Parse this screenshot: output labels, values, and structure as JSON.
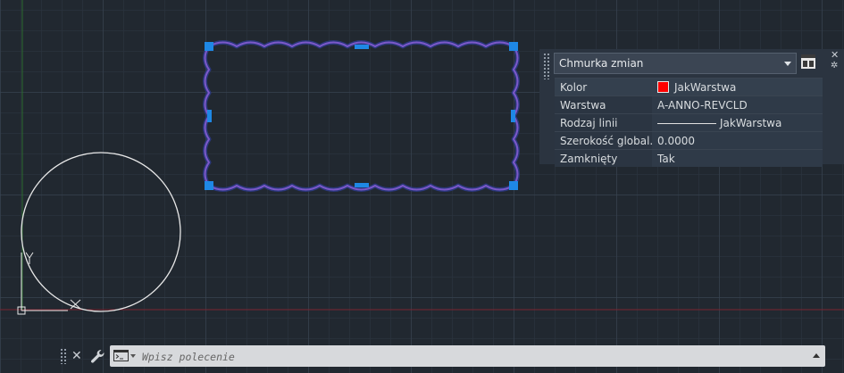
{
  "properties_panel": {
    "object_type": "Chmurka zmian",
    "rows": [
      {
        "key": "Kolor",
        "value": "JakWarstwa",
        "color": "#ff0000"
      },
      {
        "key": "Warstwa",
        "value": "A-ANNO-REVCLD"
      },
      {
        "key": "Rodzaj linii",
        "value": "JakWarstwa"
      },
      {
        "key": "Szerokość  global...",
        "value": "0.0000"
      },
      {
        "key": "Zamknięty",
        "value": "Tak"
      }
    ]
  },
  "command_line": {
    "placeholder": "Wpisz polecenie"
  },
  "colors": {
    "background": "#212830",
    "revcloud": "#7b58c9",
    "grip": "#1e88e5",
    "x_axis": "#8b2530",
    "y_axis": "#2e6b30"
  },
  "icons": [
    "command-line-icon",
    "wrench-icon",
    "close-icon",
    "quick-select-icon",
    "gear-icon"
  ]
}
